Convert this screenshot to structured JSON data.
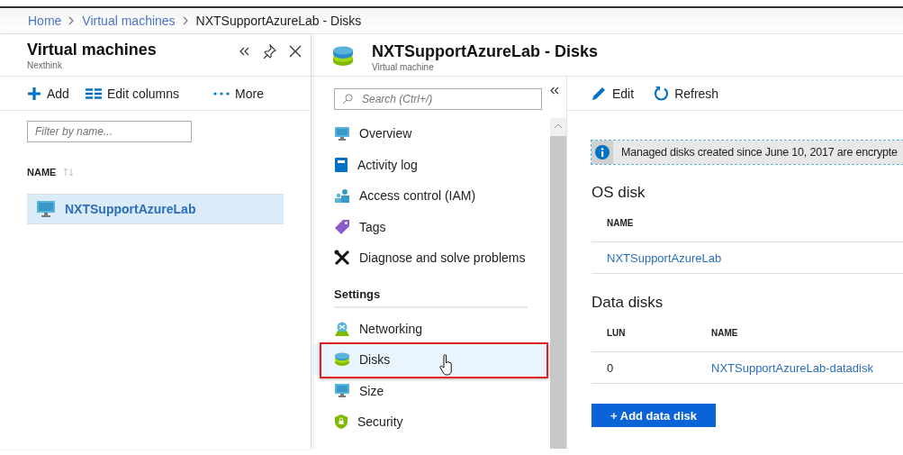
{
  "breadcrumb": [
    {
      "label": "Home",
      "link": true
    },
    {
      "label": "Virtual machines",
      "link": true
    },
    {
      "label": "NXTSupportAzureLab - Disks",
      "link": false
    }
  ],
  "left_blade": {
    "title": "Virtual machines",
    "subtitle": "Nexthink",
    "toolbar": [
      "Add",
      "Edit columns",
      "More"
    ],
    "filter": {
      "placeholder": "Filter by name..."
    },
    "column": "NAME",
    "rows": [
      {
        "name": "NXTSupportAzureLab",
        "selected": true
      }
    ]
  },
  "blade": {
    "title": "NXTSupportAzureLab - Disks",
    "subtitle": "Virtual machine",
    "search": {
      "placeholder": "Search (Ctrl+/)"
    },
    "menu": [
      {
        "kind": "item",
        "label": "Overview",
        "selected": false
      },
      {
        "kind": "item",
        "label": "Activity log",
        "selected": false
      },
      {
        "kind": "item",
        "label": "Access control (IAM)",
        "selected": false
      },
      {
        "kind": "item",
        "label": "Tags",
        "selected": false
      },
      {
        "kind": "item",
        "label": "Diagnose and solve problems",
        "selected": false
      },
      {
        "kind": "header",
        "label": "Settings"
      },
      {
        "kind": "item",
        "label": "Networking",
        "selected": false
      },
      {
        "kind": "item",
        "label": "Disks",
        "selected": true
      },
      {
        "kind": "item",
        "label": "Size",
        "selected": false
      },
      {
        "kind": "item",
        "label": "Security",
        "selected": false
      }
    ],
    "toolbar": [
      "Edit",
      "Refresh"
    ],
    "info": "Managed disks created since June 10, 2017 are encrypte",
    "os_disk": {
      "heading": "OS disk",
      "columns": [
        "NAME"
      ],
      "rows": [
        [
          "NXTSupportAzureLab"
        ]
      ]
    },
    "data_disks": {
      "heading": "Data disks",
      "columns": [
        "LUN",
        "NAME"
      ],
      "rows": [
        [
          "0",
          "NXTSupportAzureLab-datadisk"
        ]
      ]
    },
    "add_button": "+ Add data disk"
  }
}
